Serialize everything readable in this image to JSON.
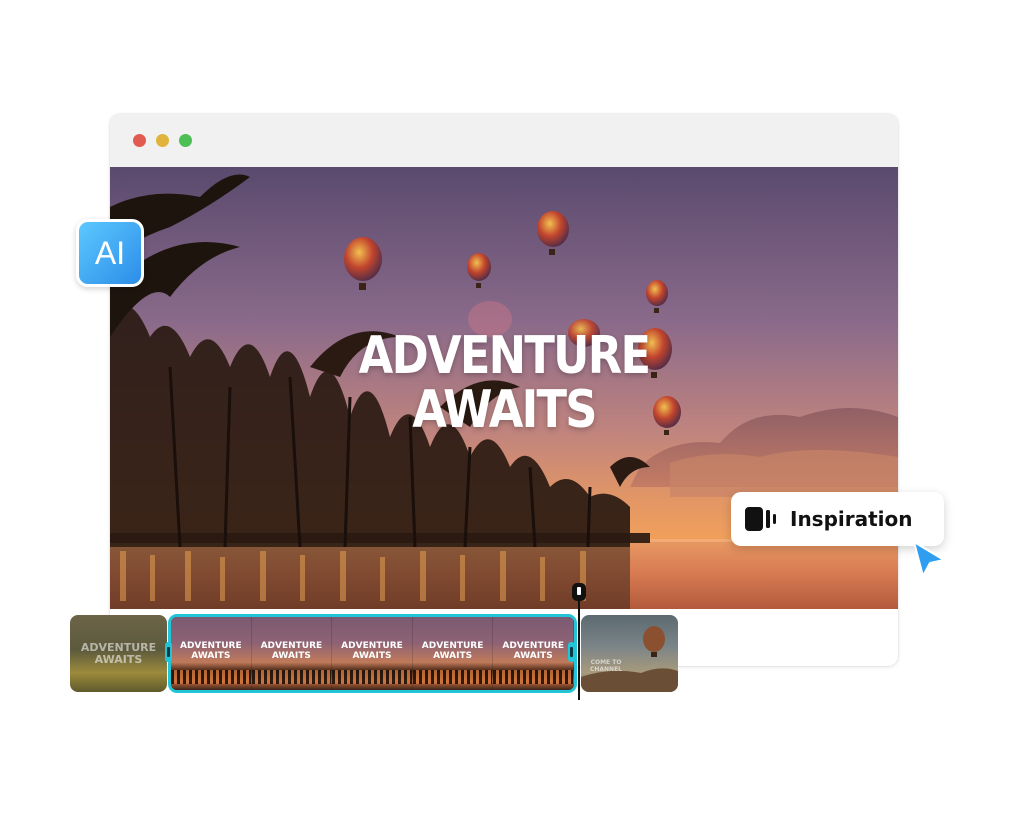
{
  "window": {
    "controls": [
      {
        "name": "close",
        "color": "#e25b50"
      },
      {
        "name": "minimize",
        "color": "#e0b43c"
      },
      {
        "name": "maximize",
        "color": "#4dbf55"
      }
    ]
  },
  "preview": {
    "headline_line1": "ADVENTURE",
    "headline_line2": "AWAITS"
  },
  "ai_badge": {
    "label": "AI",
    "color": "#3aa7f2"
  },
  "inspiration_button": {
    "label": "Inspiration",
    "icon": "video-clip-icon"
  },
  "cursor": {
    "icon": "pointer-cursor-icon",
    "color": "#2f9ef0"
  },
  "timeline": {
    "clips": [
      {
        "name": "clip-1",
        "text_line1": "ADVENTURE",
        "text_line2": "AWAITS"
      },
      {
        "name": "clip-2-selected",
        "frames": [
          {
            "text_line1": "ADVENTURE",
            "text_line2": "AWAITS"
          },
          {
            "text_line1": "ADVENTURE",
            "text_line2": "AWAITS"
          },
          {
            "text_line1": "ADVENTURE",
            "text_line2": "AWAITS"
          },
          {
            "text_line1": "ADVENTURE",
            "text_line2": "AWAITS"
          },
          {
            "text_line1": "ADVENTURE",
            "text_line2": "AWAITS"
          }
        ]
      },
      {
        "name": "clip-3",
        "text_line1": "COME TO",
        "text_line2": "CHANNEL"
      }
    ],
    "selection_color": "#22c4d8"
  }
}
